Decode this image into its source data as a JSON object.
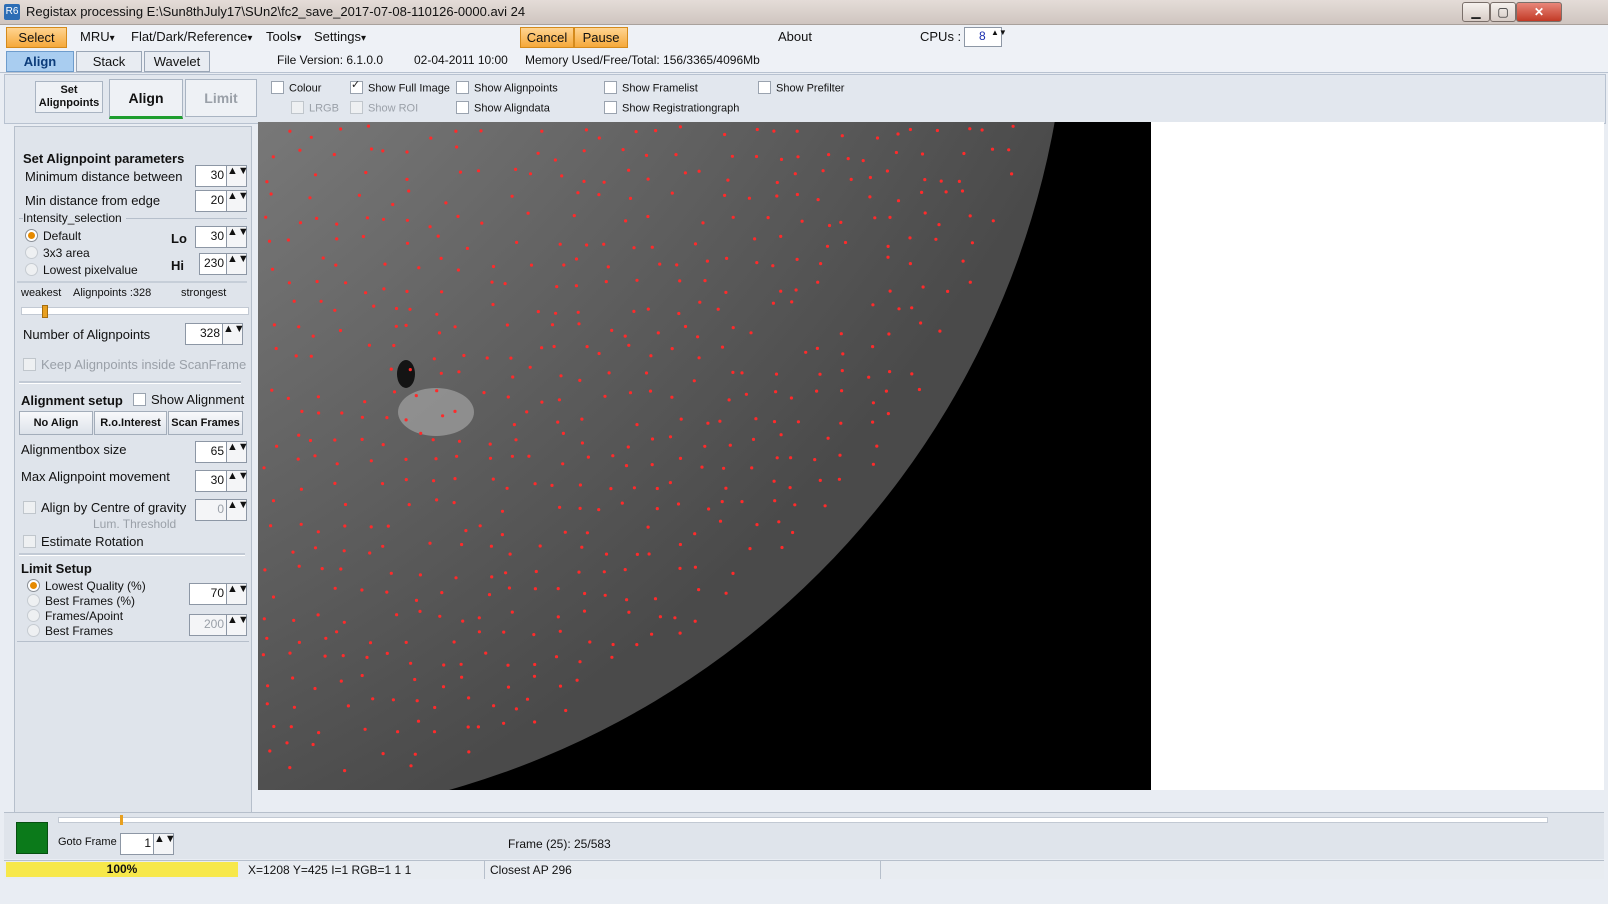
{
  "window": {
    "title": "Registax processing E:\\Sun8thJuly17\\SUn2\\fc2_save_2017-07-08-110126-0000.avi 24",
    "icon_label": "R6",
    "minimize": "▁",
    "maximize": "▢",
    "close": "✕"
  },
  "menu": {
    "select": "Select",
    "mru": "MRU",
    "flat": "Flat/Dark/Reference",
    "tools": "Tools",
    "settings": "Settings",
    "cancel": "Cancel",
    "pause": "Pause",
    "about": "About",
    "cpus_label": "CPUs :",
    "cpus_value": "8",
    "dropdown_arrow": "▾"
  },
  "tabs": {
    "align": "Align",
    "stack": "Stack",
    "wavelet": "Wavelet"
  },
  "info": {
    "file_version": "File Version: 6.1.0.0",
    "date": "02-04-2011 10:00",
    "memory": "Memory Used/Free/Total: 156/3365/4096Mb"
  },
  "subtabs": {
    "set_alignpoints": "Set Alignpoints",
    "align": "Align",
    "limit": "Limit"
  },
  "options": {
    "colour": "Colour",
    "lrgb": "LRGB",
    "show_full_image": "Show Full Image",
    "show_roi": "Show ROI",
    "show_alignpoints": "Show Alignpoints",
    "show_aligndata": "Show Aligndata",
    "show_framelist": "Show Framelist",
    "show_registrationgraph": "Show Registrationgraph",
    "show_prefilter": "Show Prefilter"
  },
  "left": {
    "params_title": "Set Alignpoint parameters",
    "min_dist_label": "Minimum distance between",
    "min_dist_value": "30",
    "min_edge_label": "Min distance from edge",
    "min_edge_value": "20",
    "intensity_label": "Intensity_selection",
    "default_label": "Default",
    "area_label": "3x3 area",
    "lowest_label": "Lowest pixelvalue",
    "lo_label": "Lo",
    "lo_value": "30",
    "hi_label": "Hi",
    "hi_value": "230",
    "weakest": "weakest",
    "alignpoints_count": "Alignpoints :328",
    "strongest": "strongest",
    "num_alignpoints_label": "Number of Alignpoints",
    "num_alignpoints_value": "328",
    "keep_inside": "Keep Alignpoints inside ScanFrame",
    "alignment_setup": "Alignment setup",
    "show_alignment": "Show Alignment",
    "no_align": "No Align",
    "roi": "R.o.Interest",
    "scan_frames": "Scan Frames",
    "box_size_label": "Alignmentbox size",
    "box_size_value": "65",
    "max_move_label": "Max Alignpoint movement",
    "max_move_value": "30",
    "centre_gravity": "Align by Centre of gravity",
    "lum_threshold": "Lum. Threshold",
    "lum_value": "0",
    "estimate_rotation": "Estimate Rotation",
    "limit_setup": "Limit Setup",
    "lowest_quality": "Lowest Quality (%)",
    "best_frames_pct": "Best Frames (%)",
    "frames_apoint": "Frames/Apoint",
    "best_frames": "Best Frames",
    "limit_value": "70",
    "limit_value2": "200",
    "spin_arrows": "▲▼"
  },
  "bottom": {
    "goto_frame": "Goto Frame",
    "goto_value": "1",
    "frame_label": "Frame (25): 25/583",
    "frame_position": 0.041
  },
  "status": {
    "zoom": "100%",
    "coords": "X=1208 Y=425 I=1 RGB=1 1 1",
    "closest_ap": "Closest AP 296"
  },
  "colors": {
    "orange": "#f5a83a",
    "accent_blue": "#a9cdf0",
    "alignpoint_red": "#ff2a2a",
    "frame_green": "#0b7a1a",
    "zoom_yellow": "#f7e84a"
  }
}
